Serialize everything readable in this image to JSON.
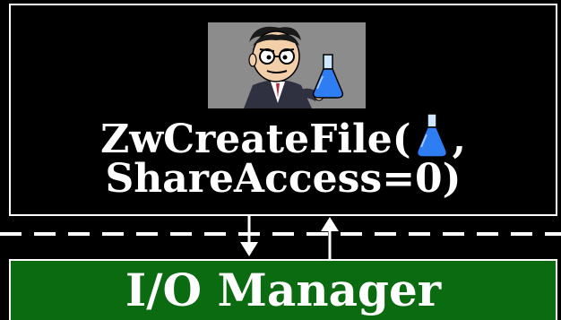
{
  "top_box": {
    "call_line_1_prefix": "ZwCreateFile(",
    "call_line_1_suffix": ",",
    "call_line_2": "ShareAccess=0)",
    "inline_icon": "flask-icon"
  },
  "illustration": {
    "icon": "scientist-holding-flask-icon"
  },
  "bottom_box": {
    "label": "I/O Manager"
  },
  "colors": {
    "background": "#000000",
    "text": "#ffffff",
    "manager_fill": "#0a6b10",
    "illustration_bg": "#8c8c8c",
    "flask_liquid": "#2e7df2"
  }
}
